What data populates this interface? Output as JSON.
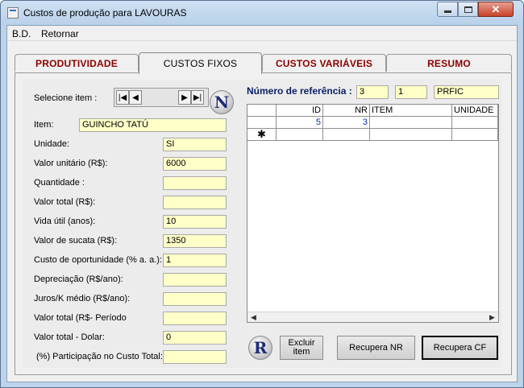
{
  "window": {
    "title": "Custos de produção para LAVOURAS"
  },
  "menu": {
    "bd": "B.D.",
    "retornar": "Retornar"
  },
  "tabs": [
    "PRODUTIVIDADE",
    "CUSTOS FIXOS",
    "CUSTOS VARIÁVEIS",
    "RESUMO"
  ],
  "form": {
    "selecione_label": "Selecione item :",
    "nav_badge": "N",
    "rows": [
      {
        "label": "Item:",
        "value": "GUINCHO TATÚ"
      },
      {
        "label": "Unidade:",
        "value": "SI"
      },
      {
        "label": "Valor unitário (R$):",
        "value": "6000"
      },
      {
        "label": "Quantidade :",
        "value": ""
      },
      {
        "label": "Valor total (R$):",
        "value": ""
      },
      {
        "label": "Vida útil (anos):",
        "value": "10"
      },
      {
        "label": "Valor de sucata (R$):",
        "value": "1350"
      },
      {
        "label": "Custo de oportunidade (% a. a.):",
        "value": "1"
      },
      {
        "label": "Depreciação (R$/ano):",
        "value": ""
      },
      {
        "label": "Juros/K médio (R$/ano):",
        "value": ""
      },
      {
        "label": "Valor total (R$- Período",
        "value": ""
      },
      {
        "label": "Valor total - Dolar:",
        "value": "0"
      },
      {
        "label": "(%) Participação no Custo Total:",
        "value": ""
      }
    ]
  },
  "ref": {
    "label": "Número de referência :",
    "v1": "3",
    "v2": "1",
    "v3": "PRFIC"
  },
  "grid": {
    "headers": [
      "",
      "ID",
      "NR",
      "ITEM",
      "UNIDADE"
    ],
    "row1": [
      "",
      "5",
      "3",
      "",
      ""
    ],
    "newrow_marker": "✱"
  },
  "buttons": {
    "r_badge": "R",
    "excluir": "Excluir item",
    "recupera_nr": "Recupera NR",
    "recupera_cf": "Recupera CF"
  }
}
